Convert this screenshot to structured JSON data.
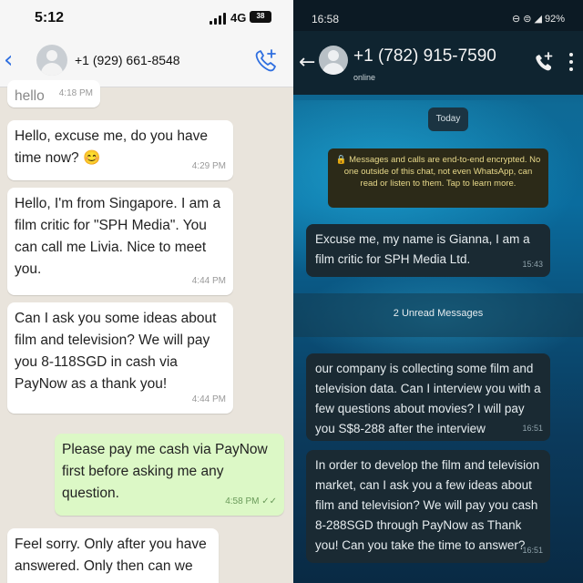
{
  "left": {
    "status": {
      "time": "5:12",
      "network": "4G",
      "battery": "38"
    },
    "header": {
      "contact_number": "+1 (929) 661-8548"
    },
    "messages": [
      {
        "direction": "in",
        "text": "hello",
        "time": "4:18 PM"
      },
      {
        "direction": "in",
        "text": "Hello, excuse me, do you have time now? 😊",
        "time": "4:29 PM"
      },
      {
        "direction": "in",
        "text": "Hello, I'm from Singapore. I am a film critic for \"SPH Media\". You can call me Livia. Nice to meet you.",
        "time": "4:44 PM"
      },
      {
        "direction": "in",
        "text": "Can I ask you some ideas about film and television? We will pay you 8-118SGD in cash via PayNow as a thank you!",
        "time": "4:44 PM"
      },
      {
        "direction": "out",
        "text": "Please pay me cash via PayNow first before asking me any question.",
        "time": "4:58 PM ✓✓"
      },
      {
        "direction": "in",
        "text": "Feel sorry. Only after you have answered. Only then can we pay",
        "time": ""
      }
    ]
  },
  "right": {
    "status": {
      "time": "16:58",
      "right": "⊖ ⊜ ◢ 92%"
    },
    "header": {
      "contact_number": "+1 (782) 915-7590",
      "presence": "online"
    },
    "date_pill": "Today",
    "system_notice": "🔒 Messages and calls are end-to-end encrypted. No one outside of this chat, not even WhatsApp, can read or listen to them. Tap to learn more.",
    "unread_label": "2 Unread Messages",
    "messages": [
      {
        "text": "Excuse me, my name is Gianna, I am a film critic for SPH Media Ltd.",
        "time": "15:43"
      },
      {
        "text": "our company is collecting some film and television data. Can I interview you with a few questions about movies? I will pay you S$8-288 after the interview",
        "time": "16:51"
      },
      {
        "text": "In order to develop the film and television market, can I ask you a few ideas about film and television? We will pay you cash 8-288SGD through PayNow as Thank you! Can you take the time to answer?",
        "time": "16:51"
      }
    ]
  },
  "colors": {
    "ios_link": "#2f6fe0",
    "outgoing_bubble": "#dcf8c6",
    "dark_bubble": "#1a2a33",
    "system_notice_bg": "#2c2a18",
    "system_notice_text": "#e8d98a"
  },
  "icons": {
    "left_back": "chevron-left-icon",
    "left_call": "add-call-icon",
    "right_back": "arrow-left-icon",
    "right_call": "add-call-icon",
    "right_more": "more-vertical-icon"
  }
}
